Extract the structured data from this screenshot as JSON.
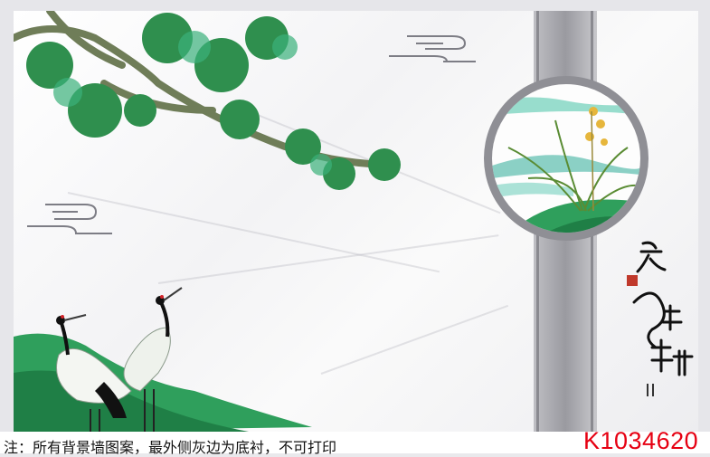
{
  "footer": {
    "note": "注：所有背景墙图案，最外侧灰边为底衬，不可打印",
    "product_code": "K1034620"
  },
  "artwork": {
    "calligraphy": "家和萬事興",
    "colors": {
      "pine": "#2f8f4e",
      "jade": "#3bb07a",
      "band": "#a3a3a8",
      "code_red": "#e60012"
    }
  }
}
